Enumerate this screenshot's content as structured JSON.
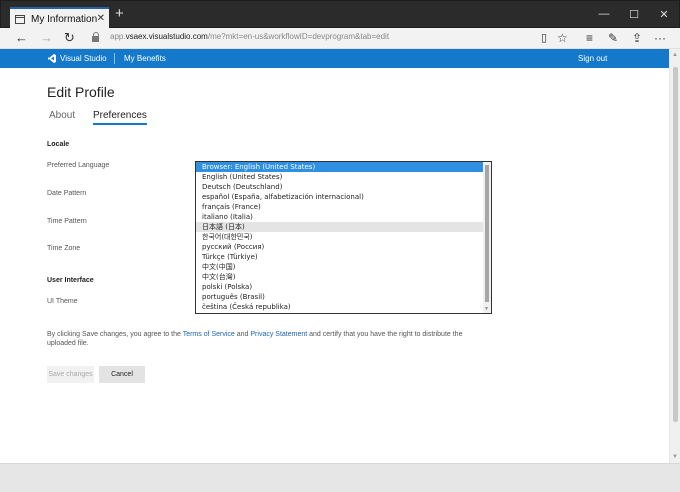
{
  "browser": {
    "tab_title": "My Information",
    "new_tab_glyph": "+",
    "url_prefix": "app.",
    "url_host": "vsaex.visualstudio.com",
    "url_rest": "/me?mkt=en-us&workflowID=devprogram&tab=edit",
    "window_buttons": [
      "—",
      "☐",
      "✕"
    ],
    "icons": [
      "back-icon",
      "forward-icon",
      "refresh-icon",
      "lock-icon",
      "reading-view-icon",
      "favorite-star-icon",
      "hub-icon",
      "web-note-icon",
      "share-icon",
      "more-icon"
    ]
  },
  "vsbar": {
    "brand": "Visual Studio",
    "benefits": "My Benefits",
    "signout": "Sign out",
    "color": "#1479cb"
  },
  "page": {
    "title": "Edit Profile",
    "tabs": [
      "About",
      "Preferences"
    ],
    "active_tab": "Preferences",
    "locale_header": "Locale",
    "labels": {
      "preferred_language": "Preferred Language",
      "date_pattern": "Date Pattern",
      "time_pattern": "Time Pattern",
      "time_zone": "Time Zone",
      "ui_theme": "UI Theme"
    },
    "ui_header": "User Interface",
    "legal": {
      "pre": "By clicking Save changes, you agree to the ",
      "terms": "Terms of Service",
      "and": " and ",
      "privacy": "Privacy Statement",
      "post": " and certify that you have the right to distribute the uploaded file."
    },
    "save_label": "Save changes",
    "cancel_label": "Cancel"
  },
  "language_list": {
    "selected_index": 0,
    "hover_index": 6,
    "options": [
      "Browser: English (United States)",
      "English (United States)",
      "Deutsch (Deutschland)",
      "español (España, alfabetización internacional)",
      "français (France)",
      "italiano (Italia)",
      "日本語 (日本)",
      "한국어(대한민국)",
      "русский (Россия)",
      "Türkçe (Türkiye)",
      "中文(中国)",
      "中文(台灣)",
      "polski (Polska)",
      "português (Brasil)",
      "čeština (Česká republika)"
    ]
  }
}
